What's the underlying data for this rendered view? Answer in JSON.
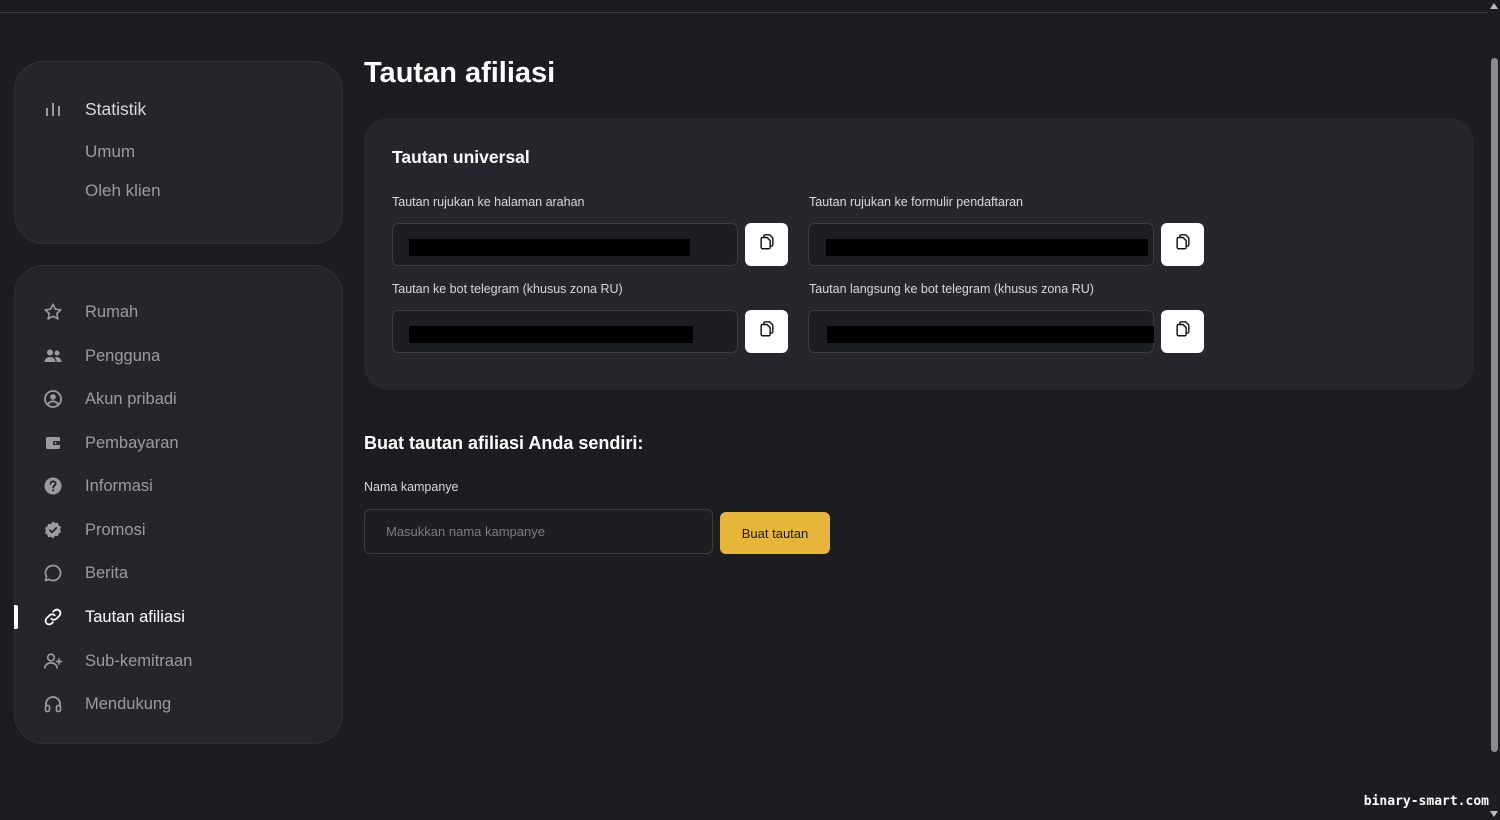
{
  "sidebar": {
    "stats": {
      "title": "Statistik",
      "items": [
        "Umum",
        "Oleh klien"
      ]
    },
    "nav": [
      {
        "label": "Rumah",
        "icon": "star-icon"
      },
      {
        "label": "Pengguna",
        "icon": "users-icon"
      },
      {
        "label": "Akun pribadi",
        "icon": "user-circle-icon"
      },
      {
        "label": "Pembayaran",
        "icon": "wallet-icon"
      },
      {
        "label": "Informasi",
        "icon": "question-icon"
      },
      {
        "label": "Promosi",
        "icon": "badge-check-icon"
      },
      {
        "label": "Berita",
        "icon": "chat-bubble-icon"
      },
      {
        "label": "Tautan afiliasi",
        "icon": "link-icon",
        "active": true
      },
      {
        "label": "Sub-kemitraan",
        "icon": "user-plus-icon"
      },
      {
        "label": "Mendukung",
        "icon": "headphones-icon"
      }
    ]
  },
  "main": {
    "title": "Tautan afiliasi",
    "universal": {
      "title": "Tautan universal",
      "links": [
        {
          "label": "Tautan rujukan ke halaman arahan"
        },
        {
          "label": "Tautan rujukan ke formulir pendaftaran"
        },
        {
          "label": "Tautan ke bot telegram (khusus zona RU)"
        },
        {
          "label": "Tautan langsung ke bot telegram (khusus zona RU)"
        }
      ]
    },
    "custom": {
      "title": "Buat tautan afiliasi Anda sendiri:",
      "campaign_label": "Nama kampanye",
      "campaign_placeholder": "Masukkan nama kampanye",
      "button_label": "Buat tautan"
    }
  },
  "watermark": "binary-smart.com",
  "colors": {
    "background": "#1c1d21",
    "panel": "#25262b",
    "accent": "#e6b63a"
  }
}
